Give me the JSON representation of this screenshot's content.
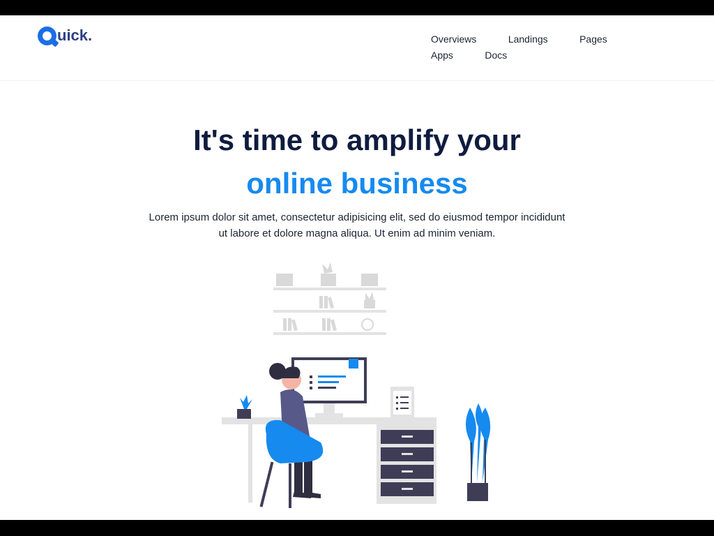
{
  "logo": {
    "text": "uick.",
    "mark": "Q"
  },
  "nav": {
    "items": [
      {
        "label": "Overviews"
      },
      {
        "label": "Landings"
      },
      {
        "label": "Pages"
      },
      {
        "label": "Apps"
      },
      {
        "label": "Docs"
      }
    ]
  },
  "hero": {
    "title": "It's time to amplify your",
    "highlight": "online business",
    "description": "Lorem ipsum dolor sit amet, consectetur adipisicing elit, sed do eiusmod tempor incididunt ut labore et dolore magna aliqua. Ut enim ad minim veniam."
  },
  "colors": {
    "brand": "#1a6fe6",
    "accent": "#168aef",
    "heading": "#0f1c3f"
  },
  "illustration": {
    "icon": "workspace-illustration"
  }
}
